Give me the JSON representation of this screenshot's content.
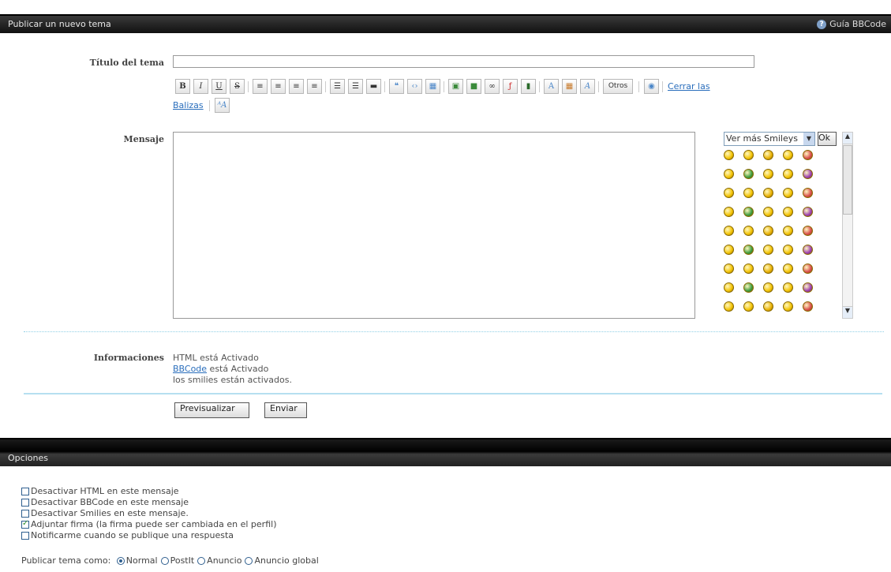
{
  "header": {
    "title": "Publicar un nuevo tema",
    "guide_label": "Guía BBCode"
  },
  "form": {
    "title_label": "Título del tema",
    "title_value": "",
    "message_label": "Mensaje",
    "info_label": "Informaciones",
    "close_tags_part1": "Cerrar las",
    "close_tags_part2": "Balizas",
    "others_button": "Otros",
    "info_html": "HTML está Activado",
    "info_bbcode_link": "BBCode",
    "info_bbcode_rest": " está Activado",
    "info_smilies": "los smilies están activados.",
    "preview_button": "Previsualizar",
    "submit_button": "Enviar"
  },
  "smilies_panel": {
    "select_value": "Ver más Smileys",
    "ok_button": "Ok"
  },
  "options": {
    "title": "Opciones",
    "checkboxes": [
      {
        "label": "Desactivar HTML en este mensaje",
        "checked": false
      },
      {
        "label": "Desactivar BBCode en este mensaje",
        "checked": false
      },
      {
        "label": "Desactivar Smilies en este mensaje.",
        "checked": false
      },
      {
        "label": "Adjuntar firma (la firma puede ser cambiada en el perfil)",
        "checked": true
      },
      {
        "label": "Notificarme cuando se publique una respuesta",
        "checked": false
      }
    ],
    "post_as_label": "Publicar tema como:",
    "post_types": [
      "Normal",
      "PostIt",
      "Anuncio",
      "Anuncio global"
    ]
  }
}
